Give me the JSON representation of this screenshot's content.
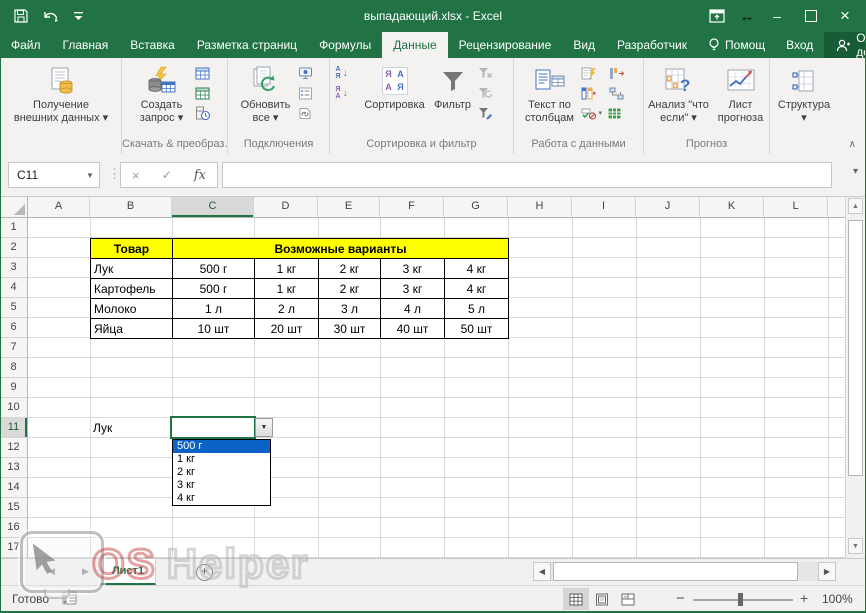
{
  "colors": {
    "accent": "#217346",
    "accent_dark": "#185c37",
    "selection_blue": "#0d63c5",
    "table_header_yellow": "#ffff00"
  },
  "title_bar": {
    "title": "выпадающий.xlsx - Excel"
  },
  "ribbon_tabs": [
    "Файл",
    "Главная",
    "Вставка",
    "Разметка страниц",
    "Формулы",
    "Данные",
    "Рецензирование",
    "Вид",
    "Разработчик"
  ],
  "tab_extras": {
    "help": "Помощ",
    "signin": "Вход",
    "share": "Общий доступ"
  },
  "ribbon": {
    "buttons": {
      "get_external": {
        "l1": "Получение",
        "l2": "внешних данных ▾"
      },
      "create_query": {
        "l1": "Создать",
        "l2": "запрос ▾"
      },
      "refresh_all": {
        "l1": "Обновить",
        "l2": "все ▾"
      },
      "sort": "Сортировка",
      "filter": "Фильтр",
      "text_to_columns": {
        "l1": "Текст по",
        "l2": "столбцам"
      },
      "what_if": {
        "l1": "Анализ \"что",
        "l2": "если\" ▾"
      },
      "forecast": {
        "l1": "Лист",
        "l2": "прогноза"
      },
      "structure": {
        "l1": "Структура",
        "l2": "▾"
      }
    },
    "group_labels": [
      "Скачать & преобраз...",
      "Подключения",
      "Сортировка и фильтр",
      "Работа с данными",
      "Прогноз"
    ]
  },
  "formula_bar": {
    "name_box": "C11",
    "fx": "fx",
    "formula": ""
  },
  "grid": {
    "columns": [
      "A",
      "B",
      "C",
      "D",
      "E",
      "F",
      "G",
      "H",
      "I",
      "J",
      "K",
      "L"
    ],
    "rows": [
      "1",
      "2",
      "3",
      "4",
      "5",
      "6",
      "7",
      "8",
      "9",
      "10",
      "11",
      "12",
      "13",
      "14",
      "15",
      "16",
      "17"
    ],
    "selected_cell": "C11"
  },
  "table": {
    "product_header": "Товар",
    "variants_header": "Возможные варианты",
    "rows": [
      {
        "name": "Лук",
        "v": [
          "500 г",
          "1 кг",
          "2 кг",
          "3 кг",
          "4 кг"
        ]
      },
      {
        "name": "Картофель",
        "v": [
          "500 г",
          "1 кг",
          "2 кг",
          "3 кг",
          "4 кг"
        ]
      },
      {
        "name": "Молоко",
        "v": [
          "1 л",
          "2 л",
          "3 л",
          "4 л",
          "5 л"
        ]
      },
      {
        "name": "Яйца",
        "v": [
          "10 шт",
          "20 шт",
          "30 шт",
          "40 шт",
          "50 шт"
        ]
      }
    ]
  },
  "cell_b11": "Лук",
  "dropdown": {
    "items": [
      "500 г",
      "1 кг",
      "2 кг",
      "3 кг",
      "4 кг"
    ],
    "selected": "500 г"
  },
  "sheet_tabs": {
    "active": "Лист1"
  },
  "status_bar": {
    "mode": "Готово",
    "zoom": "100%"
  },
  "watermark": {
    "os": "OS",
    "helper": "Helper"
  }
}
